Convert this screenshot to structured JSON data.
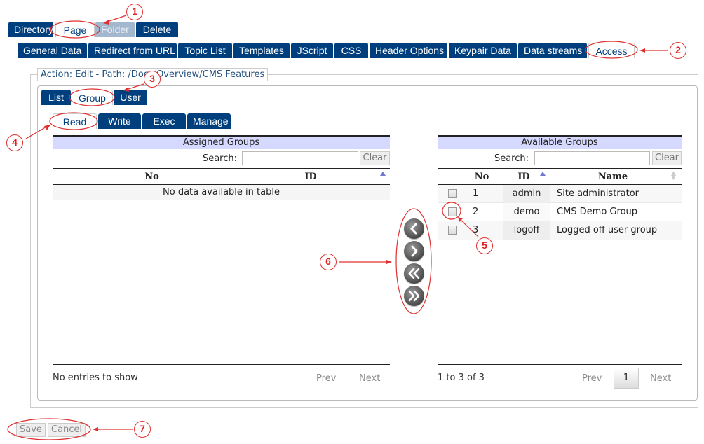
{
  "top_tabs": [
    {
      "label": "Directory",
      "state": "normal"
    },
    {
      "label": "Page",
      "state": "active"
    },
    {
      "label": "Folder",
      "state": "disabled"
    },
    {
      "label": "Delete",
      "state": "normal"
    }
  ],
  "sub_tabs": [
    {
      "label": "General Data"
    },
    {
      "label": "Redirect from URL"
    },
    {
      "label": "Topic List"
    },
    {
      "label": "Templates"
    },
    {
      "label": "JScript"
    },
    {
      "label": "CSS"
    },
    {
      "label": "Header Options"
    },
    {
      "label": "Keypair Data"
    },
    {
      "label": "Data streams"
    },
    {
      "label": "Access",
      "active": true
    }
  ],
  "legend": "Action: Edit - Path: /Docs/Overview/CMS Features",
  "type_tabs": [
    {
      "label": "List"
    },
    {
      "label": "Group",
      "active": true
    },
    {
      "label": "User"
    }
  ],
  "perm_tabs": [
    {
      "label": "Read",
      "active": true
    },
    {
      "label": "Write"
    },
    {
      "label": "Exec"
    },
    {
      "label": "Manage"
    }
  ],
  "assigned": {
    "title": "Assigned Groups",
    "search_label": "Search:",
    "search_value": "",
    "clear_label": "Clear",
    "columns": [
      "No",
      "ID"
    ],
    "empty_text": "No data available in table",
    "footer_text": "No entries to show",
    "prev_label": "Prev",
    "next_label": "Next"
  },
  "available": {
    "title": "Available Groups",
    "search_label": "Search:",
    "search_value": "",
    "clear_label": "Clear",
    "columns": [
      "No",
      "ID",
      "Name"
    ],
    "rows": [
      {
        "no": "1",
        "id": "admin",
        "name": "Site administrator",
        "checked": false
      },
      {
        "no": "2",
        "id": "demo",
        "name": "CMS Demo Group",
        "checked": false
      },
      {
        "no": "3",
        "id": "logoff",
        "name": "Logged off user group",
        "checked": false
      }
    ],
    "footer_text": "1 to 3 of 3",
    "prev_label": "Prev",
    "page": "1",
    "next_label": "Next"
  },
  "transfer_buttons": [
    {
      "name": "move-left",
      "icon": "chevron-left"
    },
    {
      "name": "move-right",
      "icon": "chevron-right"
    },
    {
      "name": "move-all-left",
      "icon": "double-chevron-left"
    },
    {
      "name": "move-all-right",
      "icon": "double-chevron-right"
    }
  ],
  "actions": {
    "save_label": "Save",
    "cancel_label": "Cancel"
  },
  "annotations": [
    "1",
    "2",
    "3",
    "4",
    "5",
    "6",
    "7"
  ],
  "colors": {
    "tab_blue": "#003f7d",
    "tab_disabled": "#a3b8cf",
    "header_lavender": "#d5d8ff",
    "annotation_red": "#e02020"
  }
}
